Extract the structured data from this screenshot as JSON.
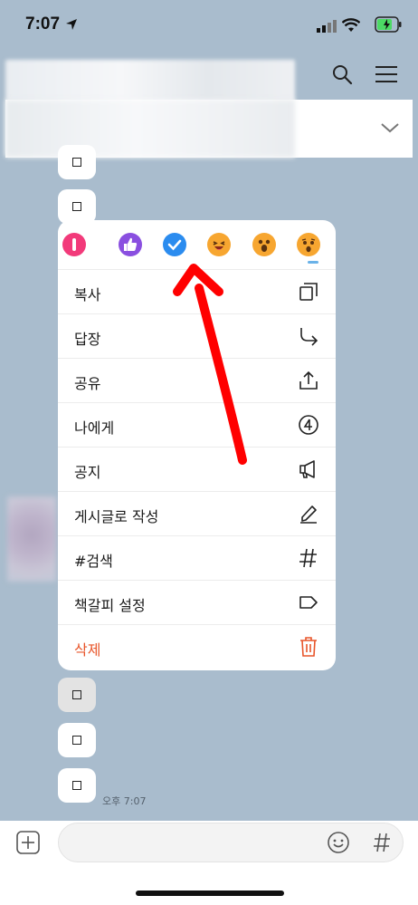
{
  "status_bar": {
    "time": "7:07"
  },
  "menu": {
    "reactions": [
      {
        "icon": "heart-alert-icon",
        "color": "#f23a7a"
      },
      {
        "icon": "thumbs-up-icon",
        "color": "#8a4fe0"
      },
      {
        "icon": "check-icon",
        "color": "#2b8cef"
      },
      {
        "icon": "laughing-face-icon",
        "color": "#f7a630"
      },
      {
        "icon": "surprised-face-icon",
        "color": "#f7a630"
      },
      {
        "icon": "sad-face-icon",
        "color": "#f7a630"
      }
    ],
    "items": [
      {
        "label": "복사",
        "icon": "copy-icon"
      },
      {
        "label": "답장",
        "icon": "reply-arrow-icon"
      },
      {
        "label": "공유",
        "icon": "share-icon"
      },
      {
        "label": "나에게",
        "icon": "to-me-icon"
      },
      {
        "label": "공지",
        "icon": "megaphone-icon"
      },
      {
        "label": "게시글로 작성",
        "icon": "pencil-icon"
      },
      {
        "label": "#검색",
        "icon": "hashtag-icon"
      },
      {
        "label": "책갈피 설정",
        "icon": "bookmark-tag-icon"
      },
      {
        "label": "삭제",
        "icon": "trash-icon"
      }
    ]
  },
  "chat": {
    "message_time": "오후 7:07"
  },
  "colors": {
    "background": "#a9bccd",
    "danger": "#e8552a",
    "annotation_arrow": "#ff0000"
  }
}
